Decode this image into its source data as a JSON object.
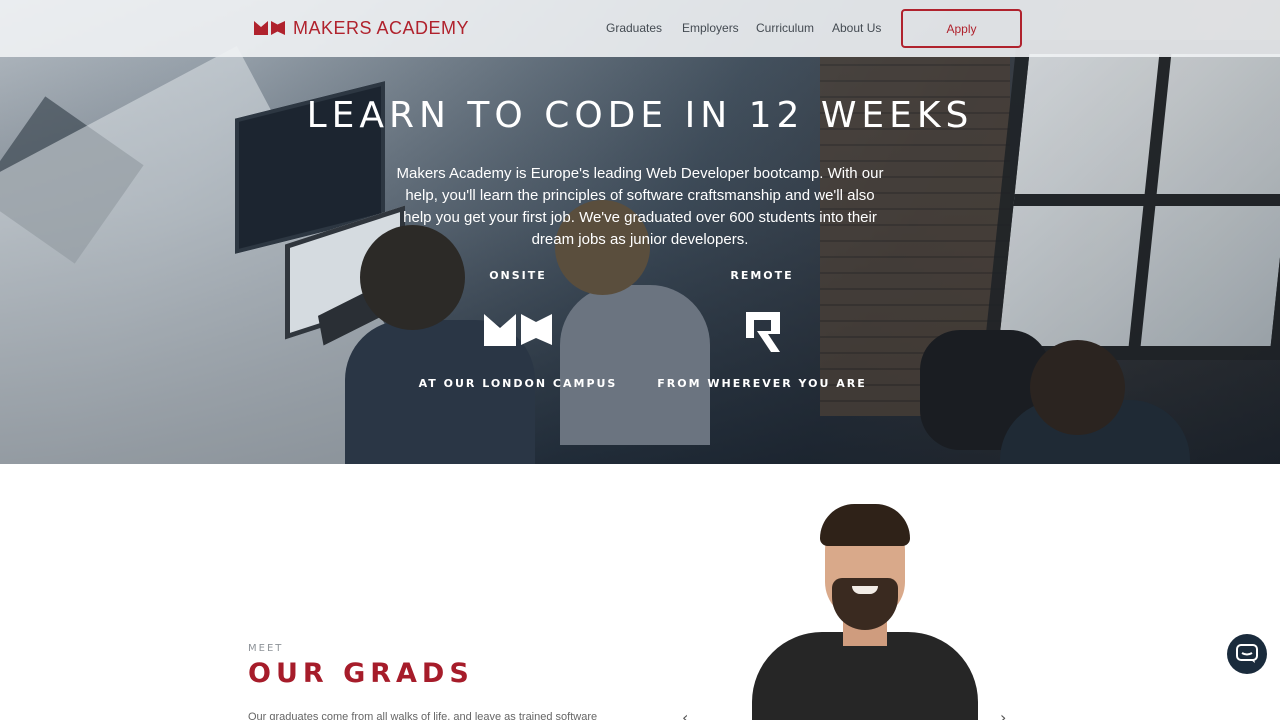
{
  "nav": {
    "logo_text": "MAKERS ACADEMY",
    "links": [
      "Graduates",
      "Employers",
      "Curriculum",
      "About Us"
    ],
    "apply_label": "Apply"
  },
  "hero": {
    "title": "LEARN TO CODE IN 12 WEEKS",
    "description": "Makers Academy is Europe's leading Web Developer bootcamp. With our help, you'll learn the principles of software craftsmanship and we'll also help you get your first job. We've graduated over 600 students into their dream jobs as junior developers.",
    "onsite": {
      "label": "ONSITE",
      "subtitle": "AT OUR LONDON CAMPUS",
      "icon": "makers-logo-icon"
    },
    "remote": {
      "label": "REMOTE",
      "subtitle": "FROM WHEREVER YOU ARE",
      "icon": "remote-logo-icon"
    }
  },
  "grads": {
    "eyebrow": "MEET",
    "title": "OUR GRADS",
    "text": "Our graduates come from all walks of life, and leave as trained software"
  },
  "colors": {
    "brand": "#b0222d",
    "chat": "#1a2b3c"
  },
  "icons": {
    "chat": "chat-icon",
    "prev": "chevron-left-icon",
    "next": "chevron-right-icon"
  }
}
